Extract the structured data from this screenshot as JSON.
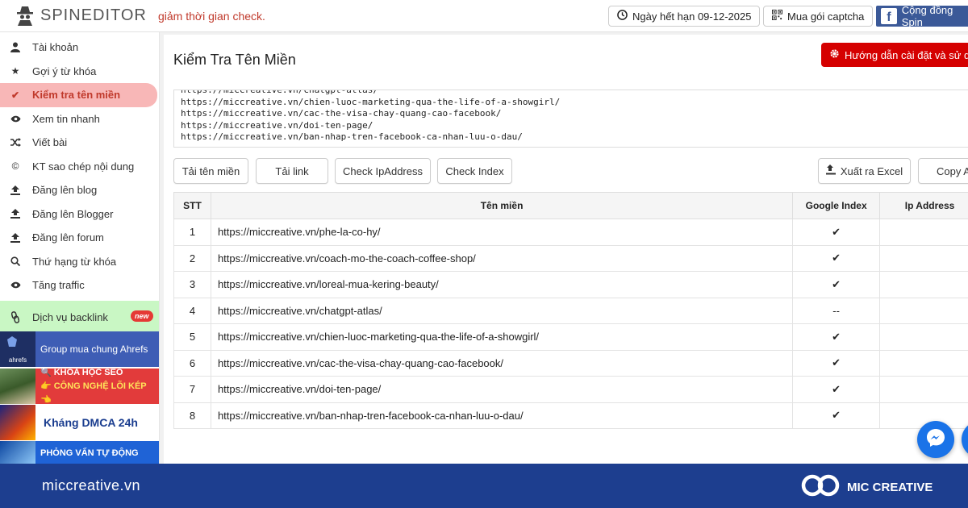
{
  "topbar": {
    "logo_text": "SPINEDITOR",
    "marquee": "giảm thời gian check.",
    "expiry_label": "Ngày hết hạn 09-12-2025",
    "captcha_label": "Mua gói captcha",
    "community_label": "Cộng đồng Spin"
  },
  "sidebar": {
    "items": [
      {
        "label": "Tài khoản",
        "icon": "user-icon"
      },
      {
        "label": "Gợi ý từ khóa",
        "icon": "star-icon"
      },
      {
        "label": "Kiểm tra tên miền",
        "icon": "check-icon",
        "active": true
      },
      {
        "label": "Xem tin nhanh",
        "icon": "eye-icon"
      },
      {
        "label": "Viết bài",
        "icon": "shuffle-icon"
      },
      {
        "label": "KT sao chép nội dung",
        "icon": "copyright-icon"
      },
      {
        "label": "Đăng lên blog",
        "icon": "upload-icon"
      },
      {
        "label": "Đăng lên Blogger",
        "icon": "upload-icon"
      },
      {
        "label": "Đăng lên forum",
        "icon": "upload-icon"
      },
      {
        "label": "Thứ hạng từ khóa",
        "icon": "search-icon"
      },
      {
        "label": "Tăng traffic",
        "icon": "eye-icon"
      }
    ],
    "backlink_label": "Dịch vụ backlink",
    "new_badge": "new",
    "promos": {
      "ahrefs_logo": "ahrefs",
      "ahrefs_text": "Group mua chung Ahrefs",
      "seo_line1": "KHÓA HỌC SEO",
      "seo_line2": "CÔNG NGHỆ LÕI KÉP",
      "dmca_text": "Kháng DMCA 24h",
      "interview_text": "PHỎNG VẤN TỰ ĐỘNG"
    }
  },
  "main": {
    "title": "Kiểm Tra Tên Miền",
    "guide_button": "Hướng dẫn cài đặt và sử dụ",
    "url_lines": [
      "https://miccreative.vn/chatgpt-atlas/",
      "https://miccreative.vn/chien-luoc-marketing-qua-the-life-of-a-showgirl/",
      "https://miccreative.vn/cac-the-visa-chay-quang-cao-facebook/",
      "https://miccreative.vn/doi-ten-page/",
      "https://miccreative.vn/ban-nhap-tren-facebook-ca-nhan-luu-o-dau/"
    ],
    "buttons": {
      "load_domain": "Tải tên miền",
      "load_link": "Tải link",
      "check_ip": "Check IpAddress",
      "check_index": "Check Index",
      "export_excel": "Xuất ra Excel",
      "copy_all": "Copy A"
    },
    "table": {
      "headers": [
        "STT",
        "Tên miền",
        "Google Index",
        "Ip Address"
      ],
      "rows": [
        {
          "stt": "1",
          "domain": "https://miccreative.vn/phe-la-co-hy/",
          "index": "✔",
          "ip": ""
        },
        {
          "stt": "2",
          "domain": "https://miccreative.vn/coach-mo-the-coach-coffee-shop/",
          "index": "✔",
          "ip": ""
        },
        {
          "stt": "3",
          "domain": "https://miccreative.vn/loreal-mua-kering-beauty/",
          "index": "✔",
          "ip": ""
        },
        {
          "stt": "4",
          "domain": "https://miccreative.vn/chatgpt-atlas/",
          "index": "--",
          "ip": ""
        },
        {
          "stt": "5",
          "domain": "https://miccreative.vn/chien-luoc-marketing-qua-the-life-of-a-showgirl/",
          "index": "✔",
          "ip": ""
        },
        {
          "stt": "6",
          "domain": "https://miccreative.vn/cac-the-visa-chay-quang-cao-facebook/",
          "index": "✔",
          "ip": ""
        },
        {
          "stt": "7",
          "domain": "https://miccreative.vn/doi-ten-page/",
          "index": "✔",
          "ip": ""
        },
        {
          "stt": "8",
          "domain": "https://miccreative.vn/ban-nhap-tren-facebook-ca-nhan-luu-o-dau/",
          "index": "✔",
          "ip": ""
        }
      ]
    }
  },
  "footer": {
    "site": "miccreative.vn",
    "brand": "MIC CREATIVE"
  },
  "colors": {
    "accent_red": "#d50000",
    "active_bg": "#f8b7b7",
    "footer_bg": "#1d3e8f",
    "facebook": "#3b5998",
    "backlink_bg": "#c9f7c4"
  }
}
